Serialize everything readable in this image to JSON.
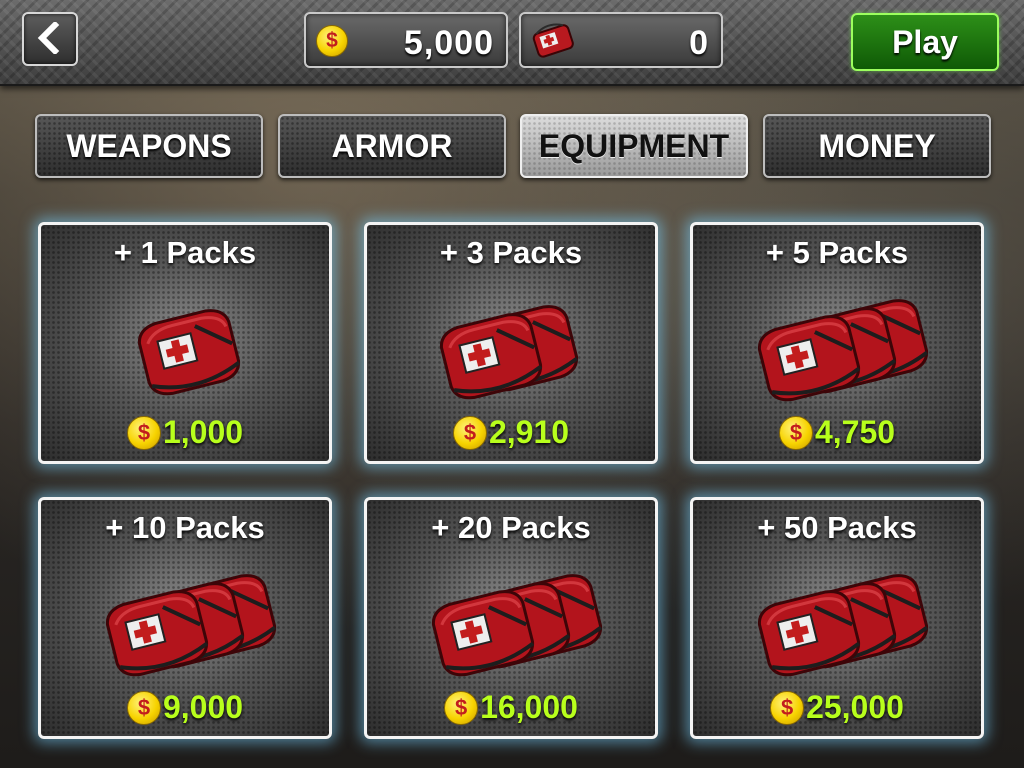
{
  "header": {
    "back_icon": "back-arrow-icon",
    "money_value": "5,000",
    "money_icon": "coin-icon",
    "kits_value": "0",
    "kits_icon": "medkit-icon",
    "play_label": "Play"
  },
  "tabs": [
    {
      "label": "WEAPONS",
      "active": false
    },
    {
      "label": "ARMOR",
      "active": false
    },
    {
      "label": "EQUIPMENT",
      "active": true
    },
    {
      "label": "MONEY",
      "active": false
    }
  ],
  "items": [
    {
      "title": "+ 1 Packs",
      "currency": "$",
      "price": "1,000",
      "icon": "medkit-bag-icon"
    },
    {
      "title": "+ 3 Packs",
      "currency": "$",
      "price": "2,910",
      "icon": "medkit-bags-icon"
    },
    {
      "title": "+ 5 Packs",
      "currency": "$",
      "price": "4,750",
      "icon": "medkit-bags-icon"
    },
    {
      "title": "+ 10 Packs",
      "currency": "$",
      "price": "9,000",
      "icon": "medkit-bags-icon"
    },
    {
      "title": "+ 20 Packs",
      "currency": "$",
      "price": "16,000",
      "icon": "medkit-bags-icon"
    },
    {
      "title": "+ 50 Packs",
      "currency": "$",
      "price": "25,000",
      "icon": "medkit-bags-icon"
    }
  ],
  "colors": {
    "price_green": "#b8ff1c",
    "card_glow": "#78d2ff",
    "play_green": "#2d8f18",
    "coin_yellow": "#f7d300"
  }
}
